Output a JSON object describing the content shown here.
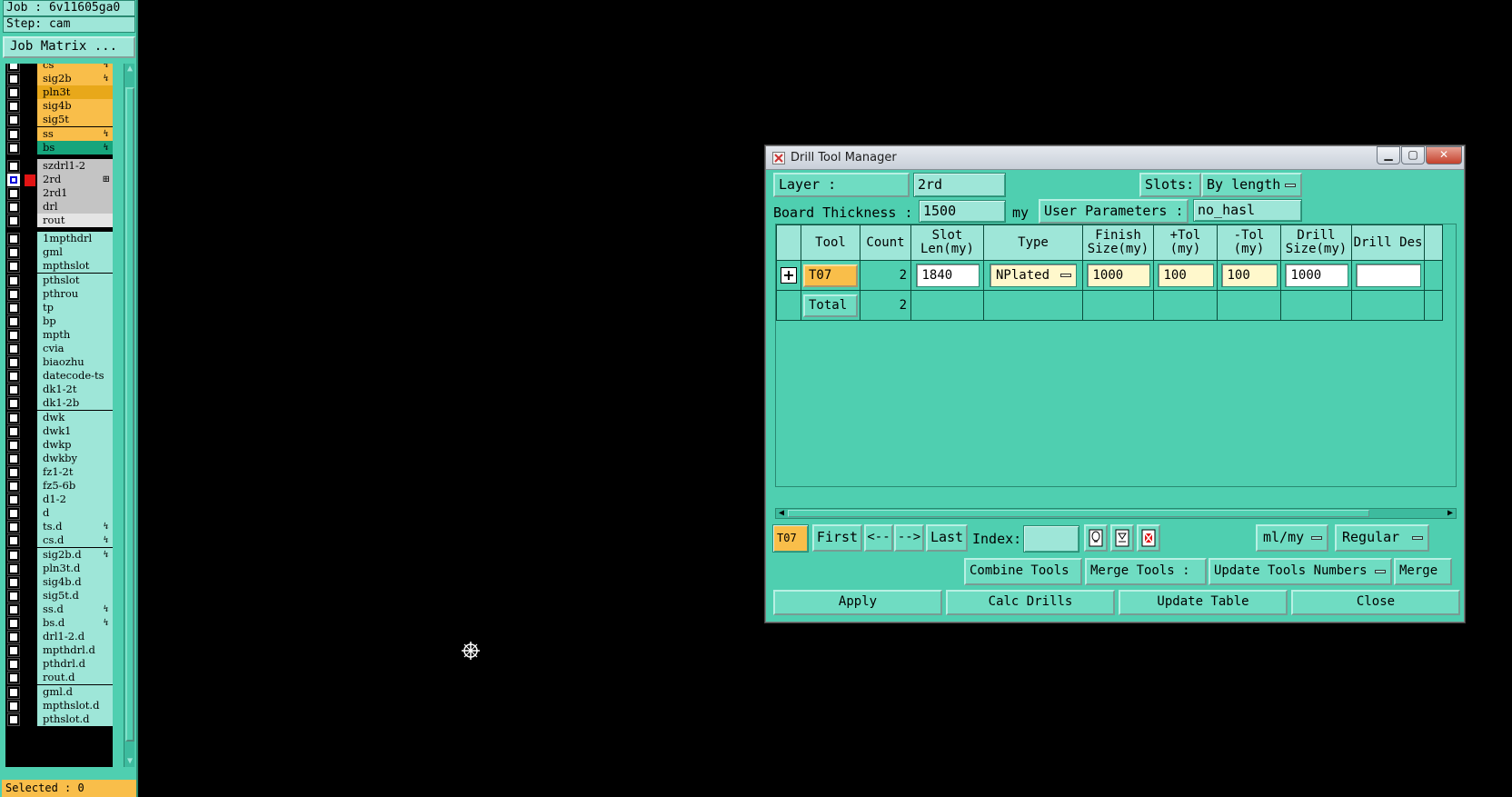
{
  "left_panel": {
    "job_label": "Job : 6v11605ga0",
    "step_label": "Step: cam",
    "job_matrix_button": "Job Matrix ...",
    "selected_label": "Selected : 0",
    "layers": [
      {
        "name": "cs",
        "color": "#f9be4a",
        "marker": "↯"
      },
      {
        "name": "sig2b",
        "color": "#f9be4a",
        "marker": "↯"
      },
      {
        "name": "pln3t",
        "color": "#e8a81a",
        "marker": ""
      },
      {
        "name": "sig4b",
        "color": "#f9be4a",
        "marker": ""
      },
      {
        "name": "sig5t",
        "color": "#f9be4a",
        "marker": ""
      },
      {
        "name": "ss",
        "color": "#f9be4a",
        "marker": "↯"
      },
      {
        "name": "bs",
        "color": "#16a57c",
        "marker": "↯"
      },
      {
        "name": "szdrl1-2",
        "color": "#c4c4c4",
        "marker": ""
      },
      {
        "name": "2rd",
        "color": "#c4c4c4",
        "marker": "⊞"
      },
      {
        "name": "2rd1",
        "color": "#c4c4c4",
        "marker": ""
      },
      {
        "name": "drl",
        "color": "#c4c4c4",
        "marker": ""
      },
      {
        "name": "rout",
        "color": "#e4e4e4",
        "marker": ""
      },
      {
        "name": "1mpthdrl",
        "color": "#9ee6d8",
        "marker": ""
      },
      {
        "name": "gml",
        "color": "#9ee6d8",
        "marker": ""
      },
      {
        "name": "mpthslot",
        "color": "#9ee6d8",
        "marker": ""
      },
      {
        "name": "pthslot",
        "color": "#9ee6d8",
        "marker": ""
      },
      {
        "name": "pthrou",
        "color": "#9ee6d8",
        "marker": ""
      },
      {
        "name": "tp",
        "color": "#9ee6d8",
        "marker": ""
      },
      {
        "name": "bp",
        "color": "#9ee6d8",
        "marker": ""
      },
      {
        "name": "mpth",
        "color": "#9ee6d8",
        "marker": ""
      },
      {
        "name": "cvia",
        "color": "#9ee6d8",
        "marker": ""
      },
      {
        "name": "biaozhu",
        "color": "#9ee6d8",
        "marker": ""
      },
      {
        "name": "datecode-ts",
        "color": "#9ee6d8",
        "marker": ""
      },
      {
        "name": "dk1-2t",
        "color": "#9ee6d8",
        "marker": ""
      },
      {
        "name": "dk1-2b",
        "color": "#9ee6d8",
        "marker": ""
      },
      {
        "name": "dwk",
        "color": "#9ee6d8",
        "marker": ""
      },
      {
        "name": "dwk1",
        "color": "#9ee6d8",
        "marker": ""
      },
      {
        "name": "dwkp",
        "color": "#9ee6d8",
        "marker": ""
      },
      {
        "name": "dwkby",
        "color": "#9ee6d8",
        "marker": ""
      },
      {
        "name": "fz1-2t",
        "color": "#9ee6d8",
        "marker": ""
      },
      {
        "name": "fz5-6b",
        "color": "#9ee6d8",
        "marker": ""
      },
      {
        "name": "d1-2",
        "color": "#9ee6d8",
        "marker": ""
      },
      {
        "name": "d",
        "color": "#9ee6d8",
        "marker": ""
      },
      {
        "name": "ts.d",
        "color": "#9ee6d8",
        "marker": "↯"
      },
      {
        "name": "cs.d",
        "color": "#9ee6d8",
        "marker": "↯"
      },
      {
        "name": "sig2b.d",
        "color": "#9ee6d8",
        "marker": "↯"
      },
      {
        "name": "pln3t.d",
        "color": "#9ee6d8",
        "marker": ""
      },
      {
        "name": "sig4b.d",
        "color": "#9ee6d8",
        "marker": ""
      },
      {
        "name": "sig5t.d",
        "color": "#9ee6d8",
        "marker": ""
      },
      {
        "name": "ss.d",
        "color": "#9ee6d8",
        "marker": "↯"
      },
      {
        "name": "bs.d",
        "color": "#9ee6d8",
        "marker": "↯"
      },
      {
        "name": "drl1-2.d",
        "color": "#9ee6d8",
        "marker": ""
      },
      {
        "name": "mpthdrl.d",
        "color": "#9ee6d8",
        "marker": ""
      },
      {
        "name": "pthdrl.d",
        "color": "#9ee6d8",
        "marker": ""
      },
      {
        "name": "rout.d",
        "color": "#9ee6d8",
        "marker": ""
      },
      {
        "name": "gml.d",
        "color": "#9ee6d8",
        "marker": ""
      },
      {
        "name": "mpthslot.d",
        "color": "#9ee6d8",
        "marker": ""
      },
      {
        "name": "pthslot.d",
        "color": "#9ee6d8",
        "marker": ""
      }
    ]
  },
  "dialog": {
    "title": "Drill Tool Manager",
    "layer_label": "Layer           :",
    "layer_value": "2rd",
    "slots_label": "Slots:",
    "slots_value": "By length",
    "board_thickness_label": "Board Thickness :",
    "board_thickness_value": "1500",
    "board_thickness_unit": "my",
    "user_params_label": "User Parameters :",
    "user_params_value": "no_hasl",
    "columns": [
      "",
      "Tool",
      "Count",
      "Slot Len(my)",
      "Type",
      "Finish Size(my)",
      "+Tol (my)",
      "-Tol (my)",
      "Drill Size(my)",
      "Drill Des"
    ],
    "rows": [
      {
        "tool": "T07",
        "count": "2",
        "slot_len": "1840",
        "type": "NPlated",
        "finish": "1000",
        "ptol": "100",
        "mtol": "100",
        "drill_size": "1000",
        "drill_des": ""
      }
    ],
    "total_row": {
      "label": "Total",
      "count": "2"
    },
    "nav": {
      "current_tool": "T07",
      "first": "First",
      "prev": "<--",
      "next": "-->",
      "last": "Last",
      "index_label": "Index:",
      "index_value": "",
      "units": "ml/my",
      "mode": "Regular"
    },
    "buttons": {
      "combine_tools": "Combine Tools",
      "merge_tools_label": "Merge Tools  :",
      "update_tools_numbers": "Update Tools Numbers",
      "merge": "Merge",
      "apply": "Apply",
      "calc_drills": "Calc Drills",
      "update_table": "Update Table",
      "close": "Close"
    }
  }
}
